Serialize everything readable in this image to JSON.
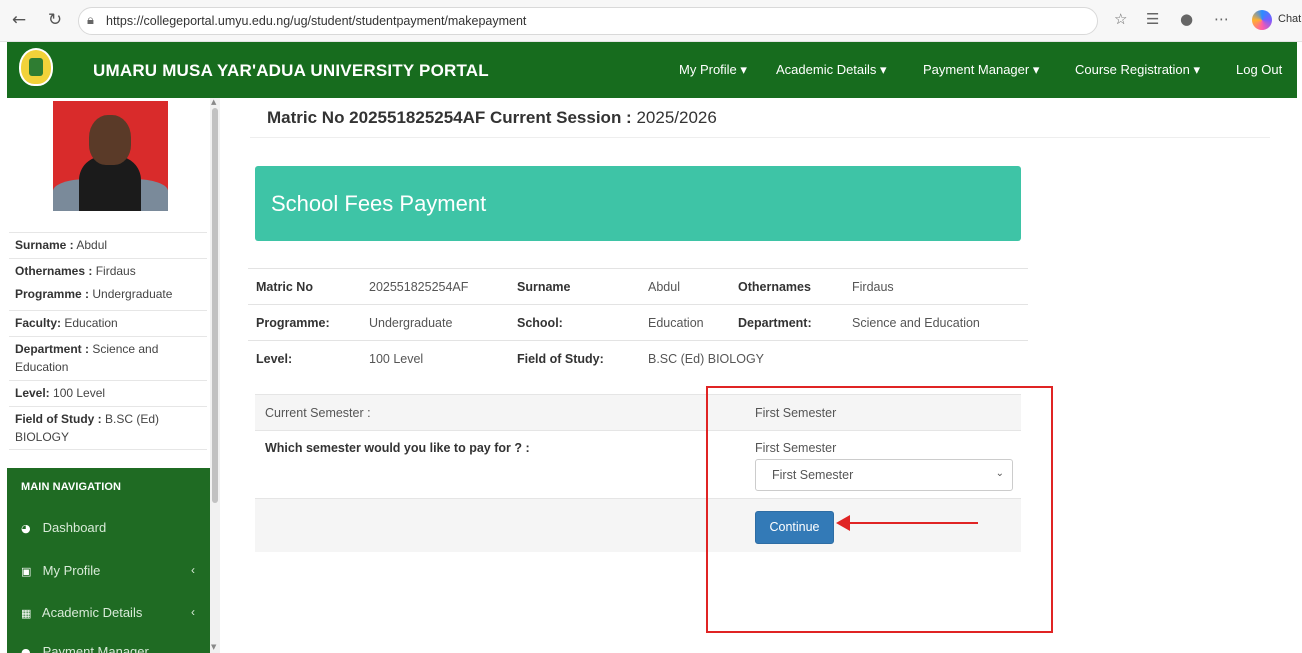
{
  "browser": {
    "url": "https://collegeportal.umyu.edu.ng/ug/student/studentpayment/makepayment",
    "chat_label": "Chat"
  },
  "header": {
    "brand": "UMARU MUSA YAR'ADUA UNIVERSITY PORTAL",
    "menu": [
      "My Profile ▾",
      "Academic Details ▾",
      "Payment Manager ▾",
      "Course Registration ▾",
      "Log Out"
    ]
  },
  "sidebar": {
    "info": [
      {
        "key": "Surname :",
        "value": "Abdul"
      },
      {
        "key": "Othernames :",
        "value": "Firdaus"
      },
      {
        "key": "Programme :",
        "value": "Undergraduate"
      },
      {
        "key": "Faculty:",
        "value": "Education"
      },
      {
        "key": "Department :",
        "value": "Science and Education"
      },
      {
        "key": "Level:",
        "value": "100 Level"
      },
      {
        "key": "Field of Study :",
        "value": "B.SC (Ed) BIOLOGY"
      }
    ],
    "nav_title": "MAIN NAVIGATION",
    "nav_items": [
      "Dashboard",
      "My Profile",
      "Academic Details",
      "Payment Manager"
    ]
  },
  "main": {
    "matric_label": "Matric No 202551825254AF Current Session :",
    "session": "2025/2026",
    "banner_title": "School Fees Payment",
    "details": [
      [
        "Matric No",
        "202551825254AF",
        "Surname",
        "Abdul",
        "Othernames",
        "Firdaus"
      ],
      [
        "Programme:",
        "Undergraduate",
        "School:",
        "Education",
        "Department:",
        "Science and Education"
      ],
      [
        "Level:",
        "100 Level",
        "Field of Study:",
        "B.SC (Ed) BIOLOGY",
        "",
        ""
      ]
    ],
    "current_semester_label": "Current Semester :",
    "current_semester_value": "First Semester",
    "which_semester_label": "Which semester would you like to pay for ? :",
    "which_semester_value": "First Semester",
    "select_value": "First Semester",
    "continue_label": "Continue"
  },
  "colors": {
    "header_green": "#176c1e",
    "banner_teal": "#3ec4a6",
    "button_blue": "#337ab7",
    "annotation_red": "#e02424"
  }
}
